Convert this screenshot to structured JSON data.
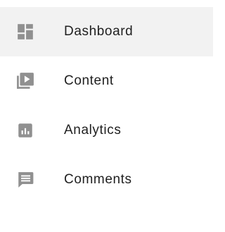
{
  "nav": {
    "items": [
      {
        "label": "Dashboard",
        "icon": "dashboard-icon",
        "active": true
      },
      {
        "label": "Content",
        "icon": "video-library-icon",
        "active": false
      },
      {
        "label": "Analytics",
        "icon": "analytics-icon",
        "active": false
      },
      {
        "label": "Comments",
        "icon": "comment-icon",
        "active": false
      }
    ],
    "colors": {
      "icon": "#909090",
      "active_background": "#f2f2f2",
      "label": "#1f1f1f"
    }
  }
}
